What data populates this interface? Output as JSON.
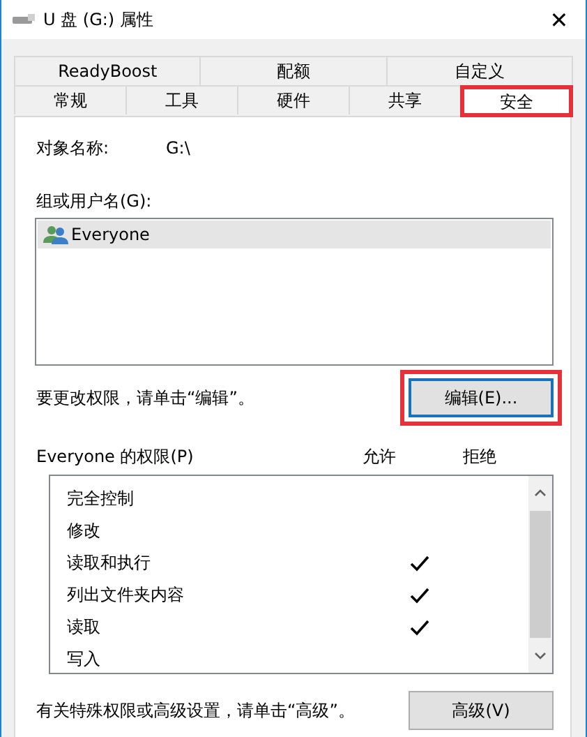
{
  "window": {
    "title": "U 盘 (G:) 属性",
    "close": "✕"
  },
  "tabs": [
    [
      {
        "label": "ReadyBoost",
        "selected": false,
        "highlighted": false
      },
      {
        "label": "配额",
        "selected": false,
        "highlighted": false
      },
      {
        "label": "自定义",
        "selected": false,
        "highlighted": false
      }
    ],
    [
      {
        "label": "常规",
        "selected": false,
        "highlighted": false
      },
      {
        "label": "工具",
        "selected": false,
        "highlighted": false
      },
      {
        "label": "硬件",
        "selected": false,
        "highlighted": false
      },
      {
        "label": "共享",
        "selected": false,
        "highlighted": false
      },
      {
        "label": "安全",
        "selected": true,
        "highlighted": true
      }
    ]
  ],
  "object_name": {
    "label": "对象名称:",
    "value": "G:\\"
  },
  "users": {
    "label": "组或用户名(G):",
    "items": [
      {
        "name": "Everyone",
        "selected": true
      }
    ]
  },
  "edit_hint": "要更改权限，请单击“编辑”。",
  "edit_button": {
    "label": "编辑(E)...",
    "highlighted": true
  },
  "permissions": {
    "label": "Everyone 的权限(P)",
    "allow_header": "允许",
    "deny_header": "拒绝",
    "rows": [
      {
        "name": "完全控制",
        "allow": false,
        "deny": false
      },
      {
        "name": "修改",
        "allow": false,
        "deny": false
      },
      {
        "name": "读取和执行",
        "allow": true,
        "deny": false
      },
      {
        "name": "列出文件夹内容",
        "allow": true,
        "deny": false
      },
      {
        "name": "读取",
        "allow": true,
        "deny": false
      },
      {
        "name": "写入",
        "allow": false,
        "deny": false
      }
    ]
  },
  "advanced_hint": "有关特殊权限或高级设置，请单击“高级”。",
  "advanced_button": {
    "label": "高级(V)"
  }
}
